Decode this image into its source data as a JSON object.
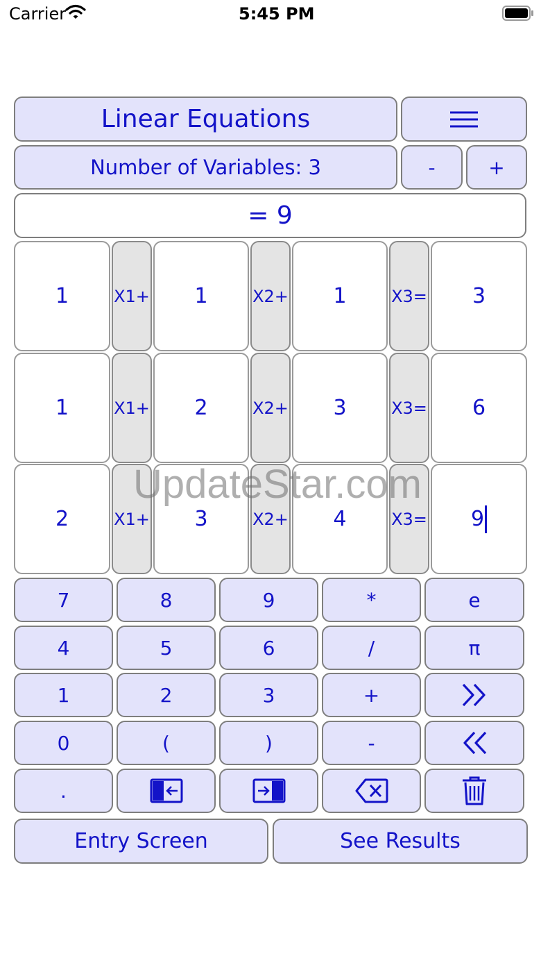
{
  "status_bar": {
    "carrier": "Carrier",
    "time": "5:45 PM"
  },
  "header": {
    "title": "Linear Equations",
    "menu_icon": "hamburger-icon"
  },
  "variables": {
    "label": "Number of Variables: 3",
    "minus": "-",
    "plus": "+"
  },
  "display": {
    "text": "= 9"
  },
  "matrix": {
    "rows": [
      {
        "c1": "1",
        "l1": "X1+",
        "c2": "1",
        "l2": "X2+",
        "c3": "1",
        "l3": "X3=",
        "r": "3"
      },
      {
        "c1": "1",
        "l1": "X1+",
        "c2": "2",
        "l2": "X2+",
        "c3": "3",
        "l3": "X3=",
        "r": "6"
      },
      {
        "c1": "2",
        "l1": "X1+",
        "c2": "3",
        "l2": "X2+",
        "c3": "4",
        "l3": "X3=",
        "r": "9"
      }
    ]
  },
  "keypad": {
    "rows": [
      [
        "7",
        "8",
        "9",
        "*",
        "e"
      ],
      [
        "4",
        "5",
        "6",
        "/",
        "π"
      ],
      [
        "1",
        "2",
        "3",
        "+",
        ""
      ],
      [
        "0",
        "(",
        ")",
        "-",
        ""
      ],
      [
        ".",
        "",
        "",
        "",
        ""
      ]
    ],
    "icons": {
      "next": "double-chevron-right-icon",
      "prev": "double-chevron-left-icon",
      "move_left": "cursor-left-icon",
      "move_right": "cursor-right-icon",
      "backspace": "backspace-icon",
      "delete": "trash-icon"
    }
  },
  "bottom": {
    "entry_label": "Entry Screen",
    "results_label": "See Results"
  },
  "watermark": "UpdateStar.com",
  "colors": {
    "accent": "#1313c8",
    "button_bg": "#e3e3fb",
    "label_bg": "#e4e4e4"
  }
}
